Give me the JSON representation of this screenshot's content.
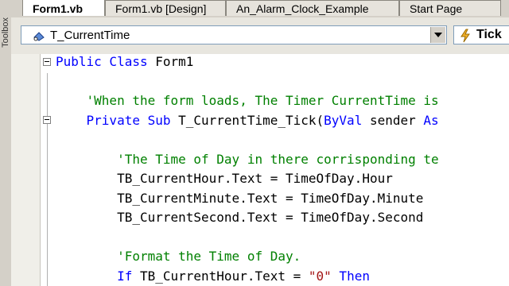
{
  "tabs": [
    {
      "label": "Form1.vb",
      "active": true
    },
    {
      "label": "Form1.vb [Design]",
      "active": false
    },
    {
      "label": "An_Alarm_Clock_Example",
      "active": false
    },
    {
      "label": "Start Page",
      "active": false
    }
  ],
  "left_strip_label": "Toolbox",
  "toolbar": {
    "object_selector": {
      "value": "T_CurrentTime",
      "icon": "component-icon"
    },
    "event_selector": {
      "value": "Tick",
      "icon": "lightning-icon"
    }
  },
  "code_lines": [
    {
      "indent": "",
      "parts": [
        {
          "t": "kw",
          "s": "Public Class "
        },
        {
          "t": "tx",
          "s": "Form1"
        }
      ]
    },
    {
      "indent": "",
      "parts": []
    },
    {
      "indent": "    ",
      "parts": [
        {
          "t": "cm",
          "s": "'When the form loads, The Timer CurrentTime is"
        }
      ]
    },
    {
      "indent": "    ",
      "parts": [
        {
          "t": "kw",
          "s": "Private Sub "
        },
        {
          "t": "tx",
          "s": "T_CurrentTime_Tick("
        },
        {
          "t": "kw",
          "s": "ByVal"
        },
        {
          "t": "tx",
          "s": " sender "
        },
        {
          "t": "kw",
          "s": "As"
        }
      ]
    },
    {
      "indent": "",
      "parts": []
    },
    {
      "indent": "        ",
      "parts": [
        {
          "t": "cm",
          "s": "'The Time of Day in there corrisponding te"
        }
      ]
    },
    {
      "indent": "        ",
      "parts": [
        {
          "t": "tx",
          "s": "TB_CurrentHour.Text = TimeOfDay.Hour"
        }
      ]
    },
    {
      "indent": "        ",
      "parts": [
        {
          "t": "tx",
          "s": "TB_CurrentMinute.Text = TimeOfDay.Minute"
        }
      ]
    },
    {
      "indent": "        ",
      "parts": [
        {
          "t": "tx",
          "s": "TB_CurrentSecond.Text = TimeOfDay.Second"
        }
      ]
    },
    {
      "indent": "",
      "parts": []
    },
    {
      "indent": "        ",
      "parts": [
        {
          "t": "cm",
          "s": "'Format the Time of Day."
        }
      ]
    },
    {
      "indent": "        ",
      "parts": [
        {
          "t": "kw",
          "s": "If "
        },
        {
          "t": "tx",
          "s": "TB_CurrentHour.Text = "
        },
        {
          "t": "st",
          "s": "\"0\""
        },
        {
          "t": "kw",
          "s": " Then"
        }
      ]
    }
  ]
}
